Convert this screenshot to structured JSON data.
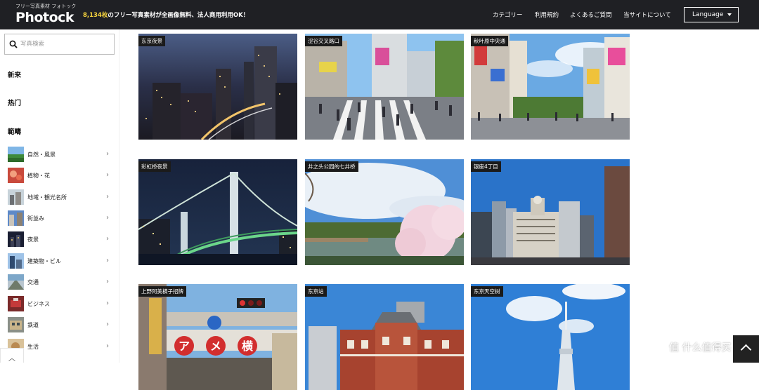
{
  "header": {
    "logo_sub": "フリー写真素材 フォトック",
    "logo_main": "Photock",
    "tagline_count": "8,134枚",
    "tagline_rest": "のフリー写真素材が全画像無料、法人商用利用OK！",
    "nav": [
      "カテゴリー",
      "利用規約",
      "よくあるご質問",
      "当サイトについて"
    ],
    "language_label": "Language"
  },
  "sidebar": {
    "search_placeholder": "写真検索",
    "section_new": "新来",
    "section_popular": "热门",
    "section_category": "範疇",
    "categories": [
      {
        "label": "自然・風景",
        "icon": "nature-thumb"
      },
      {
        "label": "植物・花",
        "icon": "flower-thumb"
      },
      {
        "label": "地域・観光名所",
        "icon": "landmark-thumb"
      },
      {
        "label": "街並み",
        "icon": "street-thumb"
      },
      {
        "label": "夜景",
        "icon": "night-thumb"
      },
      {
        "label": "建築物・ビル",
        "icon": "building-thumb"
      },
      {
        "label": "交通",
        "icon": "traffic-thumb"
      },
      {
        "label": "ビジネス",
        "icon": "business-thumb"
      },
      {
        "label": "鉄道",
        "icon": "railway-thumb"
      },
      {
        "label": "生活",
        "icon": "life-thumb"
      }
    ]
  },
  "photos": [
    {
      "label": "东京夜景"
    },
    {
      "label": "涩谷交叉路口"
    },
    {
      "label": "秋叶原中央通"
    },
    {
      "label": "彩虹桥夜景"
    },
    {
      "label": "井之头公园的七井桥"
    },
    {
      "label": "银座4丁目"
    },
    {
      "label": "上野阿美横子招牌"
    },
    {
      "label": "东京站"
    },
    {
      "label": "东京天空树"
    }
  ],
  "watermark": "值 什么值得买",
  "colors": {
    "header_bg": "#1f2024",
    "accent_yellow": "#f4d23d"
  }
}
